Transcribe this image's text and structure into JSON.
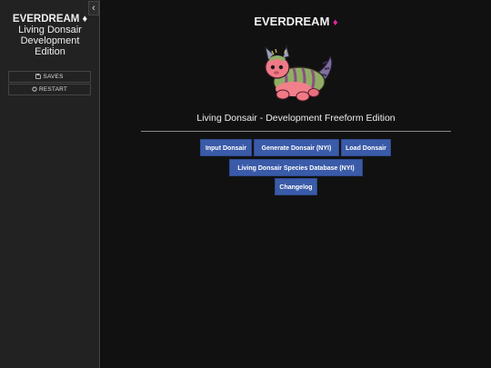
{
  "sidebar": {
    "collapse_icon": "‹",
    "title_name": "EVERDREAM",
    "title_diamond": "♦",
    "subtitle_lines": [
      "Living Donsair",
      "Development",
      "Edition"
    ],
    "saves_label": "SAVES",
    "restart_label": "RESTART"
  },
  "main": {
    "title": "EVERDREAM",
    "title_diamond": "♦",
    "subtitle": "Living Donsair - Development Freeform Edition",
    "buttons": {
      "input": "Input Donsair",
      "generate": "Generate Donsair (NYI)",
      "load": "Load Donsair",
      "species": "Living Donsair Species Database (NYI)",
      "changelog": "Changelog"
    }
  },
  "colors": {
    "accent_diamond": "#e0279b",
    "button_bg": "#3a5ba8",
    "sidebar_bg": "#222222",
    "page_bg": "#111111"
  },
  "icons": {
    "collapse": "chevron-left-icon",
    "saves": "save-icon",
    "restart": "restart-icon",
    "mascot": "donsair-creature-image"
  }
}
